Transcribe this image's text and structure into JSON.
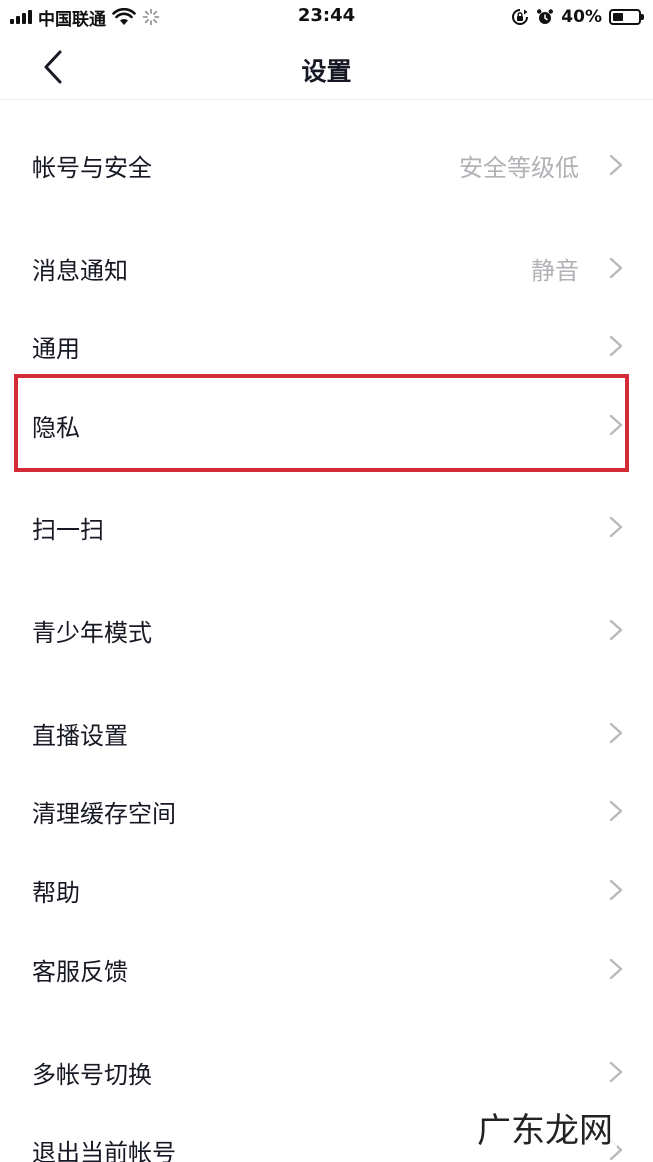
{
  "status_bar": {
    "carrier": "中国联通",
    "time": "23:44",
    "battery_percent": "40%",
    "battery_level": 0.4,
    "icons": [
      "signal-icon",
      "wifi-icon",
      "loading-icon",
      "rotation-lock-icon",
      "alarm-icon",
      "battery-icon"
    ]
  },
  "nav": {
    "title": "设置",
    "back_icon": "chevron-left-icon"
  },
  "settings": {
    "items": [
      {
        "label": "帐号与安全",
        "value": "安全等级低"
      },
      {
        "label": "消息通知",
        "value": "静音"
      },
      {
        "label": "通用",
        "value": ""
      },
      {
        "label": "隐私",
        "value": "",
        "highlighted": true
      },
      {
        "label": "扫一扫",
        "value": ""
      },
      {
        "label": "青少年模式",
        "value": ""
      },
      {
        "label": "直播设置",
        "value": ""
      },
      {
        "label": "清理缓存空间",
        "value": ""
      },
      {
        "label": "帮助",
        "value": ""
      },
      {
        "label": "客服反馈",
        "value": ""
      },
      {
        "label": "多帐号切换",
        "value": ""
      },
      {
        "label": "退出当前帐号",
        "value": ""
      }
    ]
  },
  "colors": {
    "highlight_border": "#d42a37",
    "secondary_text": "#b0b2b6",
    "chevron": "#b8b9bd"
  },
  "watermark": "广东龙网"
}
